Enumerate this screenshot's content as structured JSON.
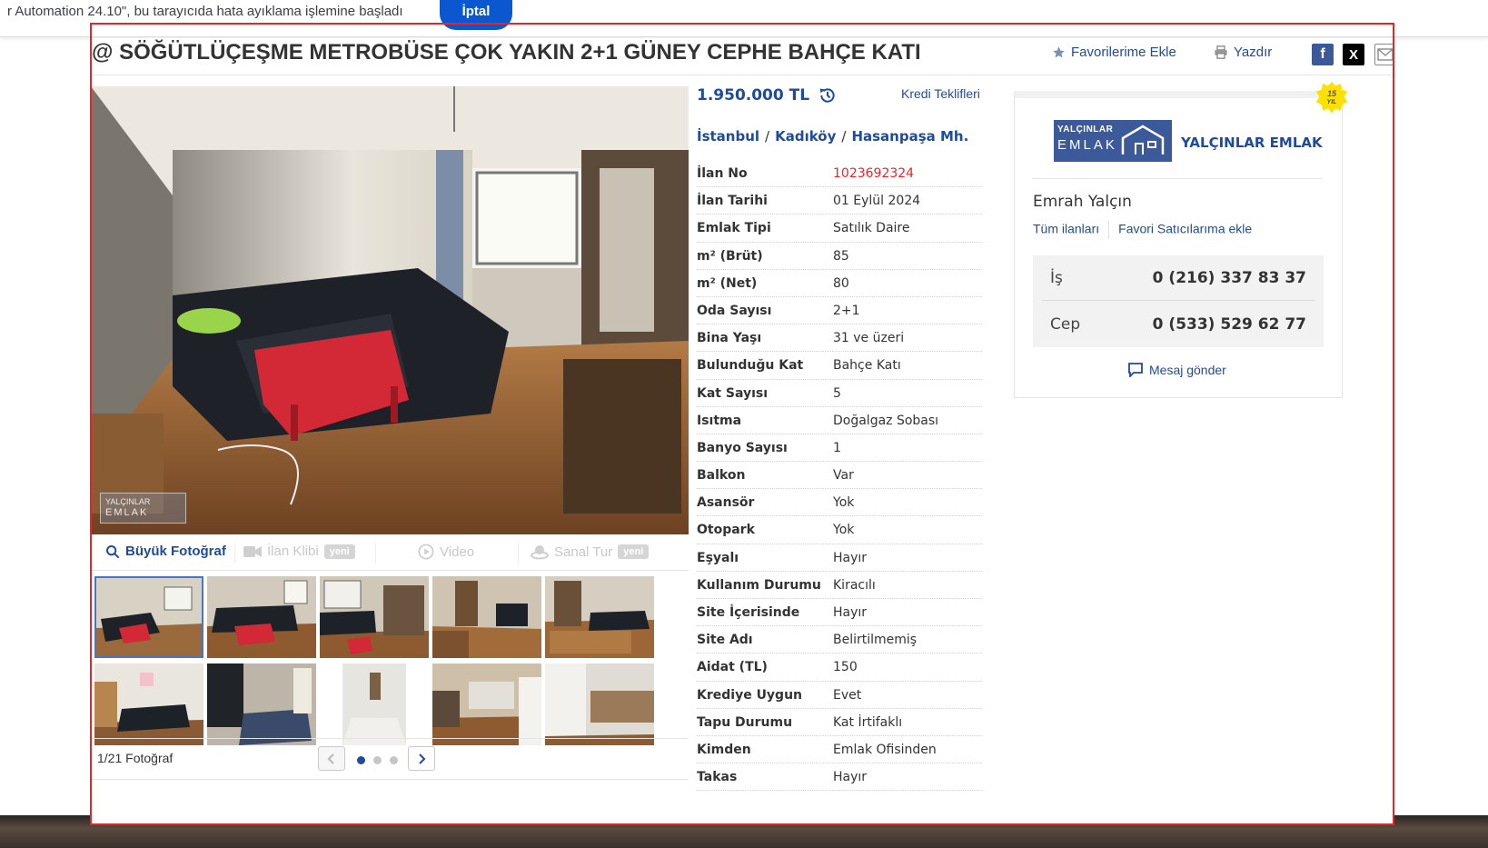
{
  "debug_banner": {
    "text": "r Automation 24.10\", bu tarayıcıda hata ayıklama işlemine başladı",
    "cancel_label": "İptal"
  },
  "listing": {
    "title": "@ SÖĞÜTLÜÇEŞME METROBÜSE ÇOK YAKIN 2+1 GÜNEY CEPHE BAHÇE KATI",
    "favorite_label": "Favorilerime Ekle",
    "print_label": "Yazdır",
    "share": {
      "facebook": "f",
      "x": "X",
      "email_icon": "envelope-icon"
    }
  },
  "gallery": {
    "watermark_line1": "YALÇINLAR",
    "watermark_line2": "EMLAK",
    "tabs": {
      "large_photo": "Büyük Fotoğraf",
      "video_clip": "İlan Klibi",
      "video": "Video",
      "virtual_tour": "Sanal Tur",
      "new_badge": "yeni"
    },
    "photo_count": "1/21 Fotoğraf"
  },
  "pricing": {
    "price": "1.950.000 TL",
    "credit_offers": "Kredi Teklifleri"
  },
  "location": {
    "city": "İstanbul",
    "district": "Kadıköy",
    "neighborhood": "Hasanpaşa Mh.",
    "separator": "/"
  },
  "details": [
    {
      "k": "İlan No",
      "v": "1023692324"
    },
    {
      "k": "İlan Tarihi",
      "v": "01 Eylül 2024"
    },
    {
      "k": "Emlak Tipi",
      "v": "Satılık Daire"
    },
    {
      "k": "m² (Brüt)",
      "v": "85"
    },
    {
      "k": "m² (Net)",
      "v": "80"
    },
    {
      "k": "Oda Sayısı",
      "v": "2+1"
    },
    {
      "k": "Bina Yaşı",
      "v": "31 ve üzeri"
    },
    {
      "k": "Bulunduğu Kat",
      "v": "Bahçe Katı"
    },
    {
      "k": "Kat Sayısı",
      "v": "5"
    },
    {
      "k": "Isıtma",
      "v": "Doğalgaz Sobası"
    },
    {
      "k": "Banyo Sayısı",
      "v": "1"
    },
    {
      "k": "Balkon",
      "v": "Var"
    },
    {
      "k": "Asansör",
      "v": "Yok"
    },
    {
      "k": "Otopark",
      "v": "Yok"
    },
    {
      "k": "Eşyalı",
      "v": "Hayır"
    },
    {
      "k": "Kullanım Durumu",
      "v": "Kiracılı"
    },
    {
      "k": "Site İçerisinde",
      "v": "Hayır"
    },
    {
      "k": "Site Adı",
      "v": "Belirtilmemiş"
    },
    {
      "k": "Aidat (TL)",
      "v": "150"
    },
    {
      "k": "Krediye Uygun",
      "v": "Evet"
    },
    {
      "k": "Tapu Durumu",
      "v": "Kat İrtifaklı"
    },
    {
      "k": "Kimden",
      "v": "Emlak Ofisinden"
    },
    {
      "k": "Takas",
      "v": "Hayır"
    }
  ],
  "seller": {
    "years_badge": "15",
    "years_suffix": "YIL",
    "logo_line1": "YALÇINLAR",
    "logo_line2": "EMLAK",
    "firm_name": "YALÇINLAR EMLAK",
    "person": "Emrah Yalçın",
    "all_listings": "Tüm ilanları",
    "add_favorite_seller": "Favori Satıcılarıma ekle",
    "phones": [
      {
        "label": "İş",
        "number": "0 (216) 337 83 37"
      },
      {
        "label": "Cep",
        "number": "0 (533) 529 62 77"
      }
    ],
    "send_message": "Mesaj gönder"
  },
  "colors": {
    "brand_blue": "#1f4b9b",
    "accent_red": "#e3262a",
    "badge_yellow": "#ffe000"
  }
}
